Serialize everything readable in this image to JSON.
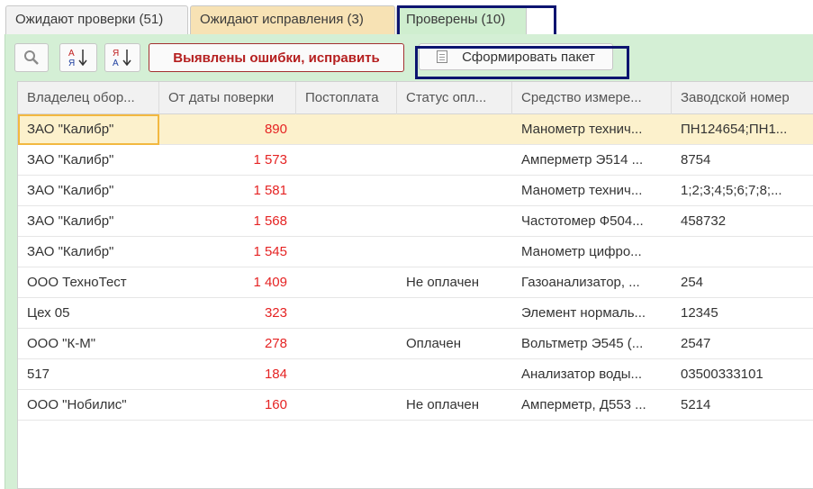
{
  "tabs": [
    {
      "label": "Ожидают проверки (51)"
    },
    {
      "label": "Ожидают исправления (3)"
    },
    {
      "label": "Проверены (10)"
    }
  ],
  "toolbar": {
    "search_icon": "search-icon",
    "sort_asc_label": "А Я",
    "sort_desc_label": "Я А",
    "errors_label": "Выявлены ошибки, исправить",
    "form_package_label": "Сформировать пакет"
  },
  "colors": {
    "panel_bg": "#d4efd5",
    "errors_text": "#b51f1f",
    "number_text": "#e52323",
    "highlight_box": "#0d1470",
    "selected_row": "#fcf1cc"
  },
  "table": {
    "columns": [
      "Владелец обор...",
      "От даты поверки",
      "Постоплата",
      "Статус опл...",
      "Средство измере...",
      "Заводской номер"
    ],
    "rows": [
      {
        "owner": "ЗАО \"Калибр\"",
        "days": "890",
        "postpay": "",
        "status": "",
        "instrument": "Манометр технич...",
        "serial": "ПН124654;ПН1..."
      },
      {
        "owner": "ЗАО \"Калибр\"",
        "days": "1 573",
        "postpay": "",
        "status": "",
        "instrument": "Амперметр Э514 ...",
        "serial": "8754"
      },
      {
        "owner": "ЗАО \"Калибр\"",
        "days": "1 581",
        "postpay": "",
        "status": "",
        "instrument": "Манометр технич...",
        "serial": "1;2;3;4;5;6;7;8;..."
      },
      {
        "owner": "ЗАО \"Калибр\"",
        "days": "1 568",
        "postpay": "",
        "status": "",
        "instrument": "Частотомер Ф504...",
        "serial": "458732"
      },
      {
        "owner": "ЗАО \"Калибр\"",
        "days": "1 545",
        "postpay": "",
        "status": "",
        "instrument": "Манометр цифро...",
        "serial": ""
      },
      {
        "owner": "ООО ТехноТест",
        "days": "1 409",
        "postpay": "",
        "status": "Не оплачен",
        "instrument": "Газоанализатор, ...",
        "serial": "254"
      },
      {
        "owner": "Цех 05",
        "days": "323",
        "postpay": "",
        "status": "",
        "instrument": "Элемент нормаль...",
        "serial": "12345"
      },
      {
        "owner": " ООО \"К-М\"",
        "days": "278",
        "postpay": "",
        "status": "Оплачен",
        "instrument": "Вольтметр Э545 (...",
        "serial": "2547"
      },
      {
        "owner": "517",
        "days": "184",
        "postpay": "",
        "status": "",
        "instrument": "Анализатор воды...",
        "serial": "03500333101"
      },
      {
        "owner": "ООО \"Нобилис\"",
        "days": "160",
        "postpay": "",
        "status": "Не оплачен",
        "instrument": "Амперметр, Д553 ...",
        "serial": "5214"
      }
    ]
  }
}
